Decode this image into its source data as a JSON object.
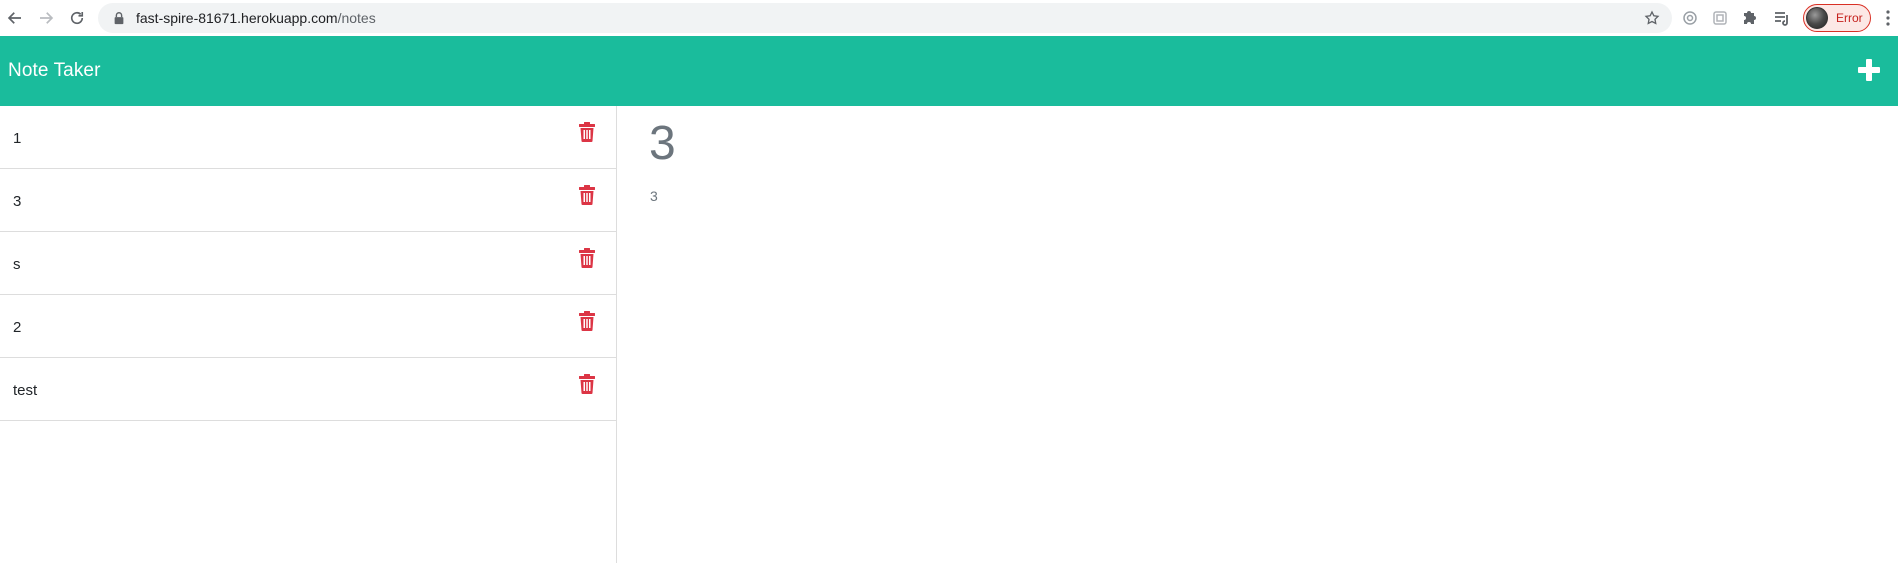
{
  "browser": {
    "url_host": "fast-spire-81671.herokuapp.com",
    "url_path": "/notes",
    "profile_status": "Error",
    "icons": [
      "back-icon",
      "forward-icon",
      "reload-icon",
      "lock-icon",
      "bookmark-star-icon",
      "extension-icon",
      "puzzle-icon",
      "media-queue-icon",
      "kebab-menu-icon"
    ]
  },
  "app": {
    "brand": "Note Taker",
    "accent_color": "#1abc9c",
    "new_note_icon": "plus-icon"
  },
  "notes": [
    {
      "title": "1"
    },
    {
      "title": "3"
    },
    {
      "title": "s"
    },
    {
      "title": "2"
    },
    {
      "title": "test"
    }
  ],
  "active_note": {
    "title": "3",
    "text": "3"
  }
}
